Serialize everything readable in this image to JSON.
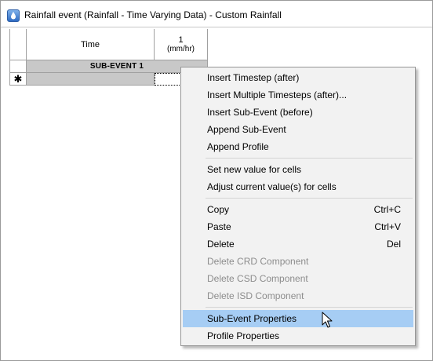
{
  "window": {
    "title": "Rainfall event (Rainfall - Time Varying Data) - Custom Rainfall"
  },
  "grid": {
    "time_header": "Time",
    "series_header": "1",
    "series_unit": "(mm/hr)",
    "subevent_label": "SUB-EVENT 1",
    "new_row_marker": "✱"
  },
  "context_menu": {
    "insert_timestep": "Insert Timestep (after)",
    "insert_multiple_timesteps": "Insert Multiple Timesteps (after)...",
    "insert_subevent": "Insert Sub-Event (before)",
    "append_subevent": "Append Sub-Event",
    "append_profile": "Append Profile",
    "set_new_value": "Set new value for cells",
    "adjust_current_value": "Adjust current value(s) for cells",
    "copy": "Copy",
    "copy_shortcut": "Ctrl+C",
    "paste": "Paste",
    "paste_shortcut": "Ctrl+V",
    "delete": "Delete",
    "delete_shortcut": "Del",
    "delete_crd": "Delete CRD Component",
    "delete_csd": "Delete CSD Component",
    "delete_isd": "Delete ISD Component",
    "subevent_properties": "Sub-Event Properties",
    "profile_properties": "Profile Properties",
    "highlighted_item": "Sub-Event Properties"
  },
  "colors": {
    "highlight": "#a6cdf4",
    "disabled_text": "#8d8d8d",
    "menu_background": "#f2f2f2",
    "subevent_row": "#c8c8c8"
  },
  "icons": {
    "app": "app-window-icon",
    "cursor": "arrow-pointer-icon",
    "new_row": "asterisk-icon"
  }
}
